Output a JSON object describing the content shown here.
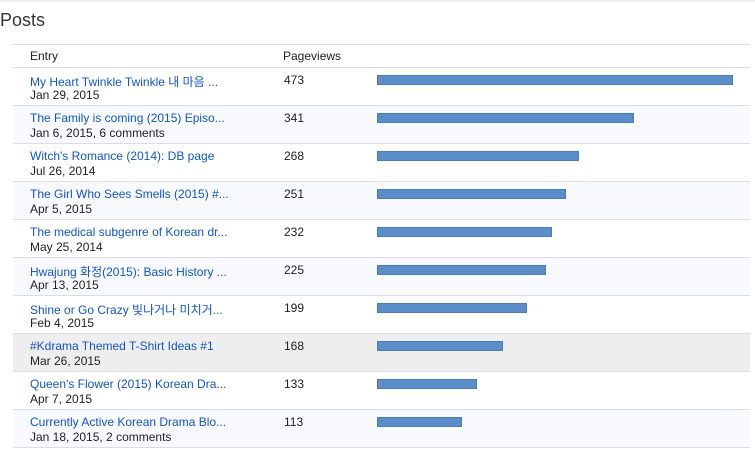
{
  "page": {
    "title": "Posts"
  },
  "table": {
    "columns": {
      "entry": "Entry",
      "pageviews": "Pageviews"
    },
    "max_pageviews": 473,
    "rows": [
      {
        "title": "My Heart Twinkle Twinkle 내 마음 ...",
        "meta": "Jan 29, 2015",
        "pageviews": "473",
        "value": 473
      },
      {
        "title": "The Family is coming (2015) Episo...",
        "meta": "Jan 6, 2015, 6 comments",
        "pageviews": "341",
        "value": 341
      },
      {
        "title": "Witch's Romance (2014): DB page",
        "meta": "Jul 26, 2014",
        "pageviews": "268",
        "value": 268
      },
      {
        "title": "The Girl Who Sees Smells (2015) #...",
        "meta": "Apr 5, 2015",
        "pageviews": "251",
        "value": 251
      },
      {
        "title": "The medical subgenre of Korean dr...",
        "meta": "May 25, 2014",
        "pageviews": "232",
        "value": 232
      },
      {
        "title": "Hwajung 화정(2015): Basic History ...",
        "meta": "Apr 13, 2015",
        "pageviews": "225",
        "value": 225
      },
      {
        "title": "Shine or Go Crazy 빛나거나 미치거...",
        "meta": "Feb 4, 2015",
        "pageviews": "199",
        "value": 199
      },
      {
        "title": "#Kdrama Themed T-Shirt Ideas #1",
        "meta": "Mar 26, 2015",
        "pageviews": "168",
        "value": 168
      },
      {
        "title": "Queen's Flower (2015) Korean Dra...",
        "meta": "Apr 7, 2015",
        "pageviews": "133",
        "value": 133
      },
      {
        "title": "Currently Active Korean Drama Blo...",
        "meta": "Jan 18, 2015, 2 comments",
        "pageviews": "113",
        "value": 113
      }
    ]
  },
  "colors": {
    "bar": "#5b8ec9",
    "link": "#1155cc",
    "row_alt": "#f7f9fc",
    "row_hover": "#eeeeee"
  }
}
